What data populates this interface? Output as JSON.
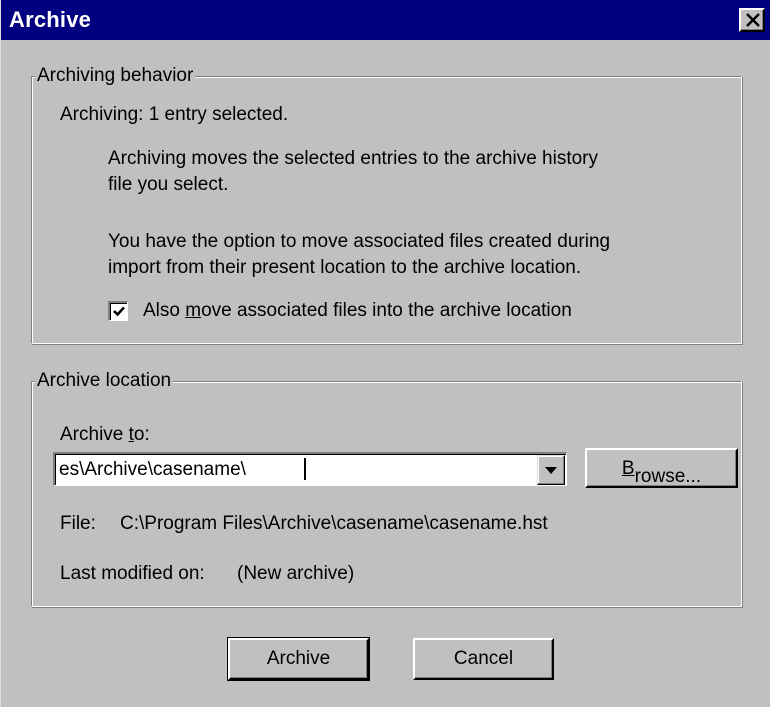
{
  "window": {
    "title": "Archive"
  },
  "behavior": {
    "group_label": "Archiving behavior",
    "status": "Archiving:  1 entry selected.",
    "description_line1": "Archiving moves the selected entries to the archive history",
    "description_line2": "file you select.",
    "option_line1": "You have the option to move associated files created during",
    "option_line2": "import from their present location to the archive location.",
    "checkbox": {
      "label_prefix": "Also ",
      "label_mnemonic": "m",
      "label_suffix": "ove associated files into the archive location",
      "checked": true
    }
  },
  "location": {
    "group_label": "Archive location",
    "archive_to_prefix": "Archive ",
    "archive_to_mnemonic": "t",
    "archive_to_suffix": "o:",
    "combo_value": "es\\Archive\\casename\\",
    "browse_mnemonic": "B",
    "browse_suffix": "rowse...",
    "file_label": "File:",
    "file_value": "C:\\Program Files\\Archive\\casename\\casename.hst",
    "modified_label": "Last modified on:",
    "modified_value": "(New archive)"
  },
  "buttons": {
    "archive_label": "Archive",
    "cancel_label": "Cancel"
  },
  "colors": {
    "titlebar": "#000080",
    "face": "#c0c0c0"
  },
  "icons": {
    "close": "close-icon",
    "dropdown": "chevron-down-icon",
    "check": "checkmark-icon"
  }
}
